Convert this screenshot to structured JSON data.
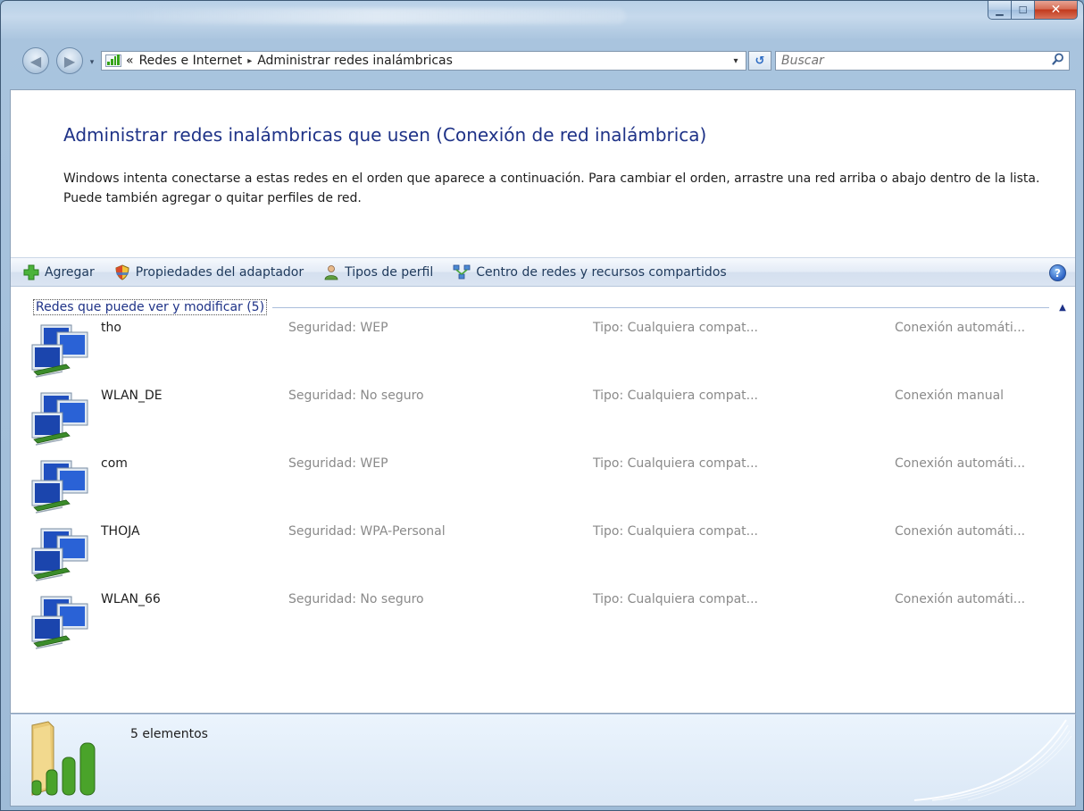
{
  "window": {
    "minimize_glyph": "▁",
    "maximize_glyph": "☐",
    "close_glyph": "✕"
  },
  "nav": {
    "back_glyph": "◀",
    "forward_glyph": "▶",
    "dropdown_glyph": "▾",
    "breadcrumb_prefix": "«",
    "breadcrumbs": [
      "Redes e Internet",
      "Administrar redes inalámbricas"
    ],
    "breadcrumb_separator": "▸",
    "address_dropdown_glyph": "▾",
    "refresh_glyph": "↺",
    "search_placeholder": "Buscar"
  },
  "page": {
    "title": "Administrar redes inalámbricas que usen (Conexión de red inalámbrica)",
    "description": "Windows intenta conectarse a estas redes en el orden que aparece a continuación. Para cambiar el orden, arrastre una red arriba o abajo dentro de la lista. Puede también agregar o quitar perfiles de red."
  },
  "toolbar": {
    "items": [
      {
        "label": "Agregar",
        "icon": "green-plus-icon"
      },
      {
        "label": "Propiedades del adaptador",
        "icon": "shield-icon"
      },
      {
        "label": "Tipos de perfil",
        "icon": "user-icon"
      },
      {
        "label": "Centro de redes y recursos compartidos",
        "icon": "network-center-icon"
      }
    ],
    "help_glyph": "?"
  },
  "group": {
    "label": "Redes que puede ver y modificar (5)",
    "toggle_glyph": "▲"
  },
  "networks": [
    {
      "name": "tho",
      "security": "Seguridad: WEP",
      "type": "Tipo: Cualquiera compat...",
      "connection": "Conexión automáti..."
    },
    {
      "name": "WLAN_DE",
      "security": "Seguridad: No seguro",
      "type": "Tipo: Cualquiera compat...",
      "connection": "Conexión manual"
    },
    {
      "name": "com",
      "security": "Seguridad: WEP",
      "type": "Tipo: Cualquiera compat...",
      "connection": "Conexión automáti..."
    },
    {
      "name": "THOJA",
      "security": "Seguridad: WPA-Personal",
      "type": "Tipo: Cualquiera compat...",
      "connection": "Conexión automáti..."
    },
    {
      "name": "WLAN_66",
      "security": "Seguridad: No seguro",
      "type": "Tipo: Cualquiera compat...",
      "connection": "Conexión automáti..."
    }
  ],
  "details": {
    "count_label": "5 elementos"
  },
  "colors": {
    "title_blue": "#1e3287",
    "signal_green": "#35a317",
    "gray_text": "#8a8a8a"
  }
}
